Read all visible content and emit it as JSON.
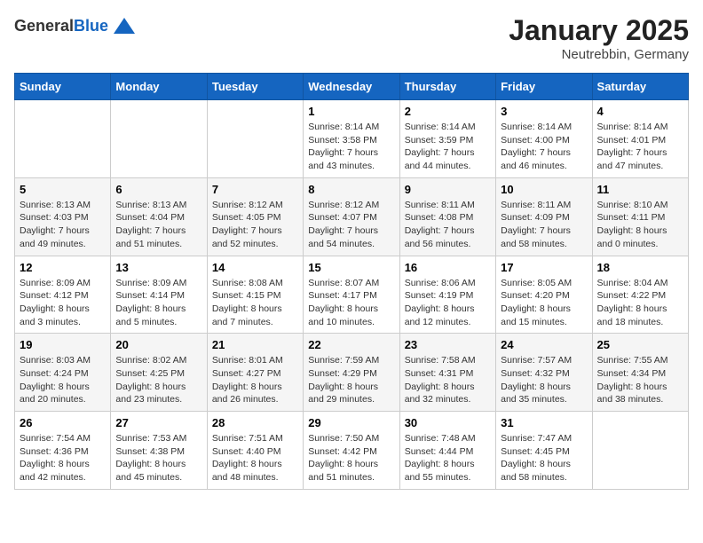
{
  "logo": {
    "general": "General",
    "blue": "Blue"
  },
  "title": {
    "month": "January 2025",
    "location": "Neutrebbin, Germany"
  },
  "headers": [
    "Sunday",
    "Monday",
    "Tuesday",
    "Wednesday",
    "Thursday",
    "Friday",
    "Saturday"
  ],
  "weeks": [
    [
      {
        "day": "",
        "info": ""
      },
      {
        "day": "",
        "info": ""
      },
      {
        "day": "",
        "info": ""
      },
      {
        "day": "1",
        "info": "Sunrise: 8:14 AM\nSunset: 3:58 PM\nDaylight: 7 hours and 43 minutes."
      },
      {
        "day": "2",
        "info": "Sunrise: 8:14 AM\nSunset: 3:59 PM\nDaylight: 7 hours and 44 minutes."
      },
      {
        "day": "3",
        "info": "Sunrise: 8:14 AM\nSunset: 4:00 PM\nDaylight: 7 hours and 46 minutes."
      },
      {
        "day": "4",
        "info": "Sunrise: 8:14 AM\nSunset: 4:01 PM\nDaylight: 7 hours and 47 minutes."
      }
    ],
    [
      {
        "day": "5",
        "info": "Sunrise: 8:13 AM\nSunset: 4:03 PM\nDaylight: 7 hours and 49 minutes."
      },
      {
        "day": "6",
        "info": "Sunrise: 8:13 AM\nSunset: 4:04 PM\nDaylight: 7 hours and 51 minutes."
      },
      {
        "day": "7",
        "info": "Sunrise: 8:12 AM\nSunset: 4:05 PM\nDaylight: 7 hours and 52 minutes."
      },
      {
        "day": "8",
        "info": "Sunrise: 8:12 AM\nSunset: 4:07 PM\nDaylight: 7 hours and 54 minutes."
      },
      {
        "day": "9",
        "info": "Sunrise: 8:11 AM\nSunset: 4:08 PM\nDaylight: 7 hours and 56 minutes."
      },
      {
        "day": "10",
        "info": "Sunrise: 8:11 AM\nSunset: 4:09 PM\nDaylight: 7 hours and 58 minutes."
      },
      {
        "day": "11",
        "info": "Sunrise: 8:10 AM\nSunset: 4:11 PM\nDaylight: 8 hours and 0 minutes."
      }
    ],
    [
      {
        "day": "12",
        "info": "Sunrise: 8:09 AM\nSunset: 4:12 PM\nDaylight: 8 hours and 3 minutes."
      },
      {
        "day": "13",
        "info": "Sunrise: 8:09 AM\nSunset: 4:14 PM\nDaylight: 8 hours and 5 minutes."
      },
      {
        "day": "14",
        "info": "Sunrise: 8:08 AM\nSunset: 4:15 PM\nDaylight: 8 hours and 7 minutes."
      },
      {
        "day": "15",
        "info": "Sunrise: 8:07 AM\nSunset: 4:17 PM\nDaylight: 8 hours and 10 minutes."
      },
      {
        "day": "16",
        "info": "Sunrise: 8:06 AM\nSunset: 4:19 PM\nDaylight: 8 hours and 12 minutes."
      },
      {
        "day": "17",
        "info": "Sunrise: 8:05 AM\nSunset: 4:20 PM\nDaylight: 8 hours and 15 minutes."
      },
      {
        "day": "18",
        "info": "Sunrise: 8:04 AM\nSunset: 4:22 PM\nDaylight: 8 hours and 18 minutes."
      }
    ],
    [
      {
        "day": "19",
        "info": "Sunrise: 8:03 AM\nSunset: 4:24 PM\nDaylight: 8 hours and 20 minutes."
      },
      {
        "day": "20",
        "info": "Sunrise: 8:02 AM\nSunset: 4:25 PM\nDaylight: 8 hours and 23 minutes."
      },
      {
        "day": "21",
        "info": "Sunrise: 8:01 AM\nSunset: 4:27 PM\nDaylight: 8 hours and 26 minutes."
      },
      {
        "day": "22",
        "info": "Sunrise: 7:59 AM\nSunset: 4:29 PM\nDaylight: 8 hours and 29 minutes."
      },
      {
        "day": "23",
        "info": "Sunrise: 7:58 AM\nSunset: 4:31 PM\nDaylight: 8 hours and 32 minutes."
      },
      {
        "day": "24",
        "info": "Sunrise: 7:57 AM\nSunset: 4:32 PM\nDaylight: 8 hours and 35 minutes."
      },
      {
        "day": "25",
        "info": "Sunrise: 7:55 AM\nSunset: 4:34 PM\nDaylight: 8 hours and 38 minutes."
      }
    ],
    [
      {
        "day": "26",
        "info": "Sunrise: 7:54 AM\nSunset: 4:36 PM\nDaylight: 8 hours and 42 minutes."
      },
      {
        "day": "27",
        "info": "Sunrise: 7:53 AM\nSunset: 4:38 PM\nDaylight: 8 hours and 45 minutes."
      },
      {
        "day": "28",
        "info": "Sunrise: 7:51 AM\nSunset: 4:40 PM\nDaylight: 8 hours and 48 minutes."
      },
      {
        "day": "29",
        "info": "Sunrise: 7:50 AM\nSunset: 4:42 PM\nDaylight: 8 hours and 51 minutes."
      },
      {
        "day": "30",
        "info": "Sunrise: 7:48 AM\nSunset: 4:44 PM\nDaylight: 8 hours and 55 minutes."
      },
      {
        "day": "31",
        "info": "Sunrise: 7:47 AM\nSunset: 4:45 PM\nDaylight: 8 hours and 58 minutes."
      },
      {
        "day": "",
        "info": ""
      }
    ]
  ]
}
